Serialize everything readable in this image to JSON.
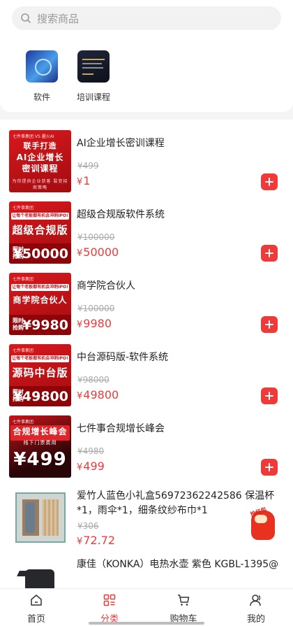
{
  "search": {
    "placeholder": "搜索商品"
  },
  "categories": [
    {
      "label": "软件"
    },
    {
      "label": "培训课程"
    }
  ],
  "products": [
    {
      "title": "AI企业增长密训课程",
      "original_price": "¥499",
      "currency": "¥",
      "price": "1",
      "image": {
        "brand": "七件事集团 VS 趣火AI",
        "headline": "联手打造",
        "main": "AI企业增长",
        "main2": "密训课程",
        "foot": "为你提供企业获客 裂变招商策略"
      }
    },
    {
      "title": "超级合规版软件系统",
      "original_price": "¥100000",
      "currency": "¥",
      "price": "50000",
      "image": {
        "brand": "七件事集团",
        "strip": "让每个老板都有机会冲刺IPO!",
        "main": "超级合规版",
        "cap": "限时抢购",
        "num": "¥50000"
      }
    },
    {
      "title": "商学院合伙人",
      "original_price": "¥100000",
      "currency": "¥",
      "price": "9980",
      "image": {
        "brand": "七件事集团",
        "strip": "让每个老板都有机会冲刺IPO!",
        "main": "商学院合伙人",
        "cap": "限时抢购",
        "num": "¥9980"
      }
    },
    {
      "title": "中台源码版-软件系统",
      "original_price": "¥98000",
      "currency": "¥",
      "price": "49800",
      "image": {
        "brand": "七件事集团",
        "strip": "让每个老板都有机会冲刺IPO!",
        "main": "源码中台版",
        "cap": "限时抢购",
        "num": "¥49800"
      }
    },
    {
      "title": "七件事合规增长峰会",
      "original_price": "¥4980",
      "currency": "¥",
      "price": "499",
      "image": {
        "brand": "七件事集团",
        "main": "合规增长峰会",
        "strip": "线下门票费用",
        "num": "¥499"
      }
    },
    {
      "title": "爱竹人蓝色小礼盒56972362242586 保温杯*1，雨伞*1，细条纹纱布巾*1",
      "original_price": "¥306",
      "currency": "¥",
      "price": "72.72"
    },
    {
      "title": "康佳（KONKA）电热水壶 紫色 KGBL-1395@",
      "original_price": "",
      "currency": "",
      "price": ""
    }
  ],
  "mascot": {
    "text": "抢红包"
  },
  "tabs": [
    {
      "label": "首页",
      "icon": "home-icon"
    },
    {
      "label": "分类",
      "icon": "category-icon"
    },
    {
      "label": "购物车",
      "icon": "cart-icon"
    },
    {
      "label": "我的",
      "icon": "profile-icon"
    }
  ],
  "colors": {
    "accent": "#f03a3a",
    "banner_red": "#d8191d"
  }
}
